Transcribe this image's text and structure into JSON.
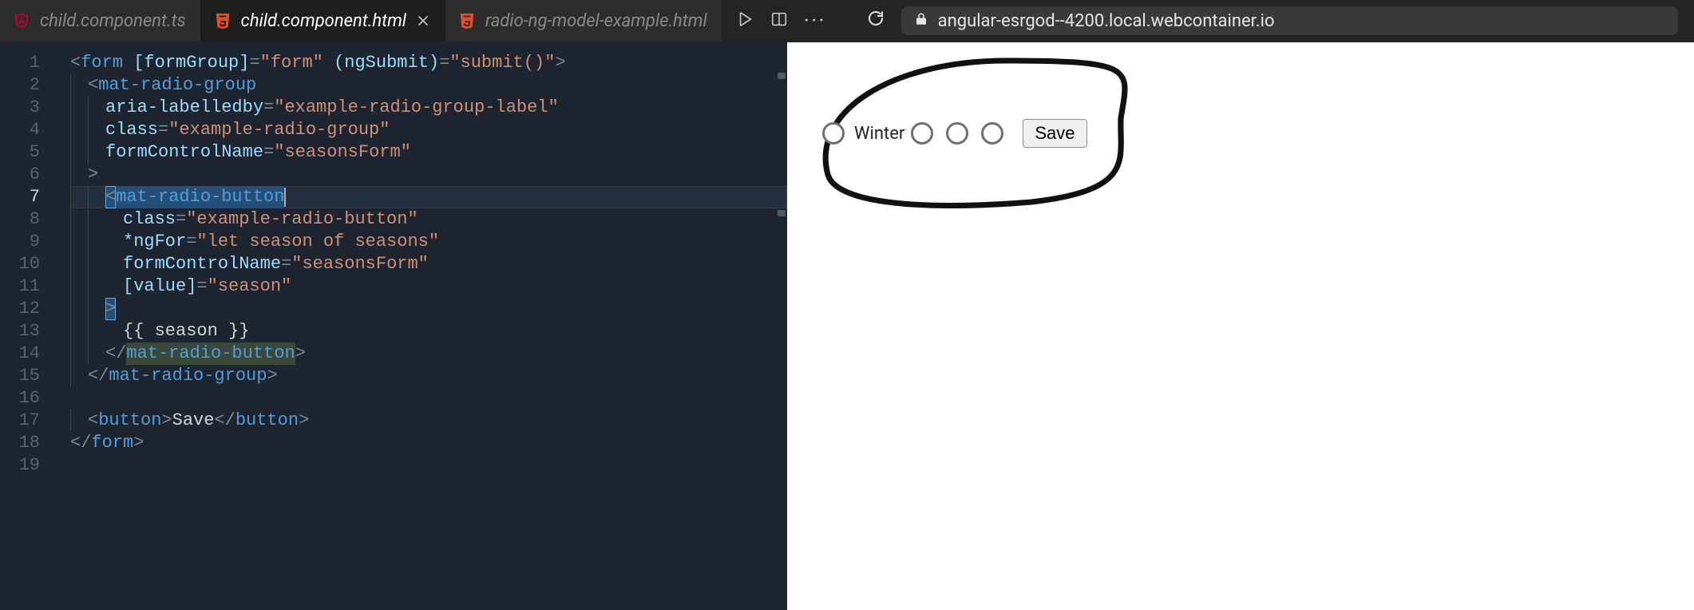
{
  "tabs": [
    {
      "label": "child.component.ts",
      "iconColor": "#C3002F",
      "active": false
    },
    {
      "label": "child.component.html",
      "iconColor": "#E44D26",
      "active": true
    },
    {
      "label": "radio-ng-model-example.html",
      "iconColor": "#E44D26",
      "active": false
    }
  ],
  "browser": {
    "url": "angular-esrgod--4200.local.webcontainer.io"
  },
  "editor": {
    "lineCount": 19,
    "currentLine": 7
  },
  "code": {
    "l1": {
      "open": "<",
      "tag": "form",
      "sp": " ",
      "a1": "[formGroup]",
      "eq": "=",
      "v1": "\"form\"",
      "sp2": " ",
      "a2": "(ngSubmit)",
      "eq2": "=",
      "v2": "\"submit()\"",
      "close": ">"
    },
    "l2": {
      "open": "<",
      "tag": "mat-radio-group"
    },
    "l3": {
      "attr": "aria-labelledby",
      "eq": "=",
      "val": "\"example-radio-group-label\""
    },
    "l4": {
      "attr": "class",
      "eq": "=",
      "val": "\"example-radio-group\""
    },
    "l5": {
      "attr": "formControlName",
      "eq": "=",
      "val": "\"seasonsForm\""
    },
    "l6": {
      "close": ">"
    },
    "l7": {
      "open": "<",
      "tag": "mat-radio-button"
    },
    "l8": {
      "attr": "class",
      "eq": "=",
      "val": "\"example-radio-button\""
    },
    "l9": {
      "attr": "*ngFor",
      "eq": "=",
      "val": "\"let season of seasons\""
    },
    "l10": {
      "attr": "formControlName",
      "eq": "=",
      "val": "\"seasonsForm\""
    },
    "l11": {
      "attr": "[value]",
      "eq": "=",
      "val": "\"season\""
    },
    "l12": {
      "close": ">"
    },
    "l13": {
      "text": "{{ season }}"
    },
    "l14": {
      "open": "</",
      "tag": "mat-radio-button",
      "close": ">"
    },
    "l15": {
      "open": "</",
      "tag": "mat-radio-group",
      "close": ">"
    },
    "l17": {
      "open": "<",
      "tag": "button",
      "close1": ">",
      "text": "Save",
      "open2": "</",
      "tag2": "button",
      "close2": ">"
    },
    "l18": {
      "open": "</",
      "tag": "form",
      "close": ">"
    }
  },
  "preview": {
    "labels": [
      "Winter",
      "",
      "",
      ""
    ],
    "saveLabel": "Save"
  }
}
